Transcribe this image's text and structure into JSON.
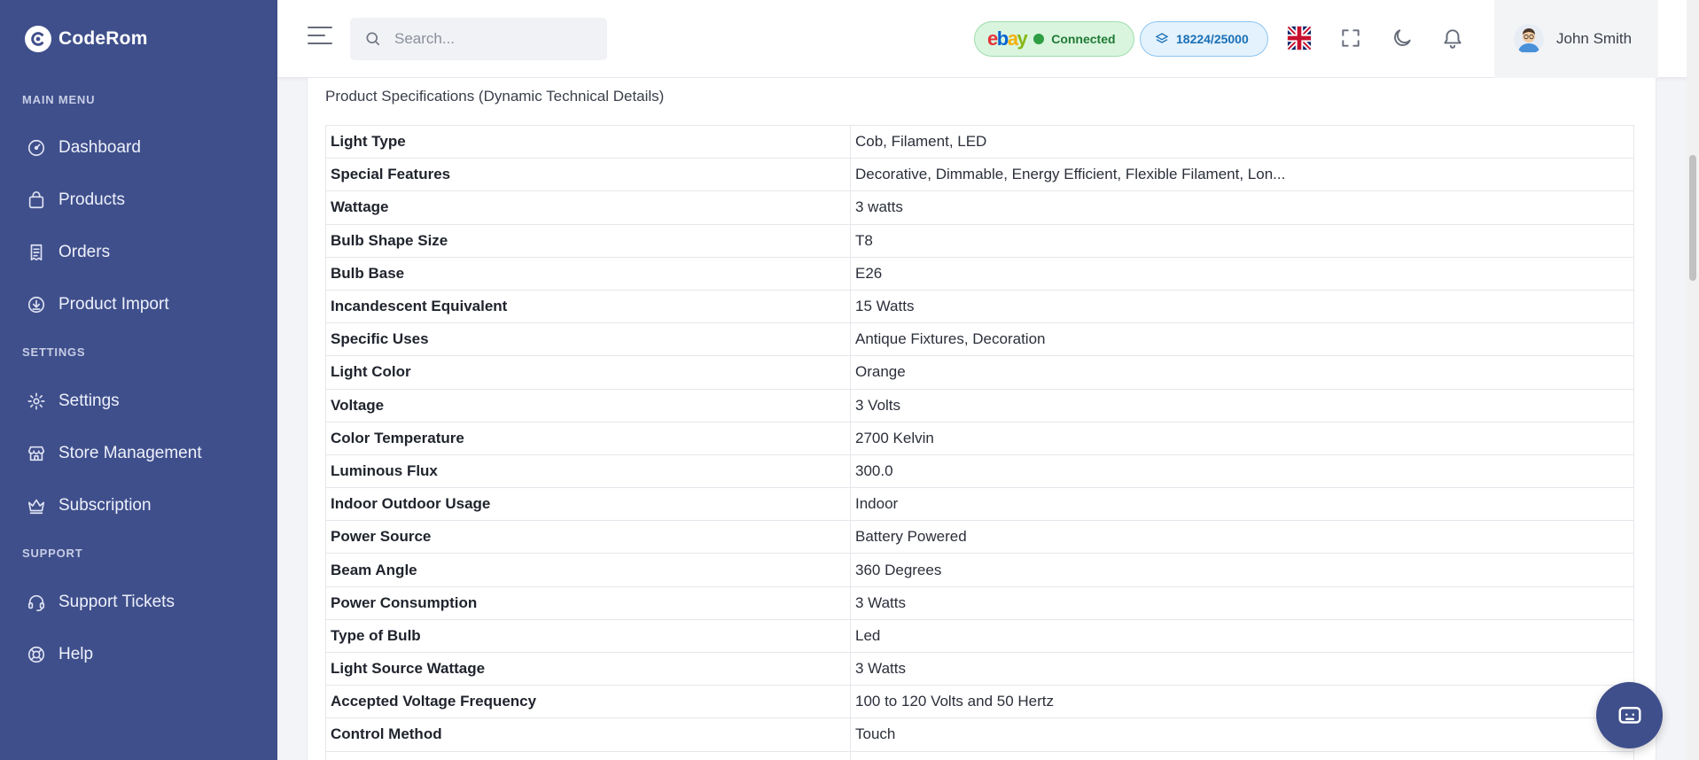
{
  "brand": {
    "name": "CodeRom"
  },
  "sidebar": {
    "sections": [
      {
        "label": "MAIN MENU"
      },
      {
        "label": "SETTINGS"
      },
      {
        "label": "SUPPORT"
      }
    ],
    "items": [
      {
        "label": "Dashboard",
        "icon": "gauge-icon"
      },
      {
        "label": "Products",
        "icon": "bag-icon"
      },
      {
        "label": "Orders",
        "icon": "receipt-icon"
      },
      {
        "label": "Product Import",
        "icon": "download-cloud-icon"
      },
      {
        "label": "Settings",
        "icon": "gear-icon"
      },
      {
        "label": "Store Management",
        "icon": "store-icon"
      },
      {
        "label": "Subscription",
        "icon": "crown-icon"
      },
      {
        "label": "Support Tickets",
        "icon": "headset-icon"
      },
      {
        "label": "Help",
        "icon": "lifebuoy-icon"
      }
    ]
  },
  "topbar": {
    "search_placeholder": "Search...",
    "ebay_status": "Connected",
    "quota": "18224/25000",
    "user_name": "John Smith"
  },
  "colors": {
    "sidebar": "#3f4f8b",
    "connected_bg": "#d9f5de",
    "quota_bg": "#e3f2fd"
  },
  "specs": {
    "title": "Product Specifications (Dynamic Technical Details)",
    "rows": [
      {
        "key": "Light Type",
        "value": "Cob, Filament, LED"
      },
      {
        "key": "Special Features",
        "value": "Decorative, Dimmable, Energy Efficient, Flexible Filament, Lon..."
      },
      {
        "key": "Wattage",
        "value": "3 watts"
      },
      {
        "key": "Bulb Shape Size",
        "value": "T8"
      },
      {
        "key": "Bulb Base",
        "value": "E26"
      },
      {
        "key": "Incandescent Equivalent",
        "value": "15 Watts"
      },
      {
        "key": "Specific Uses",
        "value": "Antique Fixtures, Decoration"
      },
      {
        "key": "Light Color",
        "value": "Orange"
      },
      {
        "key": "Voltage",
        "value": "3 Volts"
      },
      {
        "key": "Color Temperature",
        "value": "2700 Kelvin"
      },
      {
        "key": "Luminous Flux",
        "value": "300.0"
      },
      {
        "key": "Indoor Outdoor Usage",
        "value": "Indoor"
      },
      {
        "key": "Power Source",
        "value": "Battery Powered"
      },
      {
        "key": "Beam Angle",
        "value": "360 Degrees"
      },
      {
        "key": "Power Consumption",
        "value": "3 Watts"
      },
      {
        "key": "Type of Bulb",
        "value": "Led"
      },
      {
        "key": "Light Source Wattage",
        "value": "3 Watts"
      },
      {
        "key": "Accepted Voltage Frequency",
        "value": "100 to 120 Volts and 50 Hertz"
      },
      {
        "key": "Control Method",
        "value": "Touch"
      },
      {
        "key": "",
        "value": ""
      }
    ]
  }
}
